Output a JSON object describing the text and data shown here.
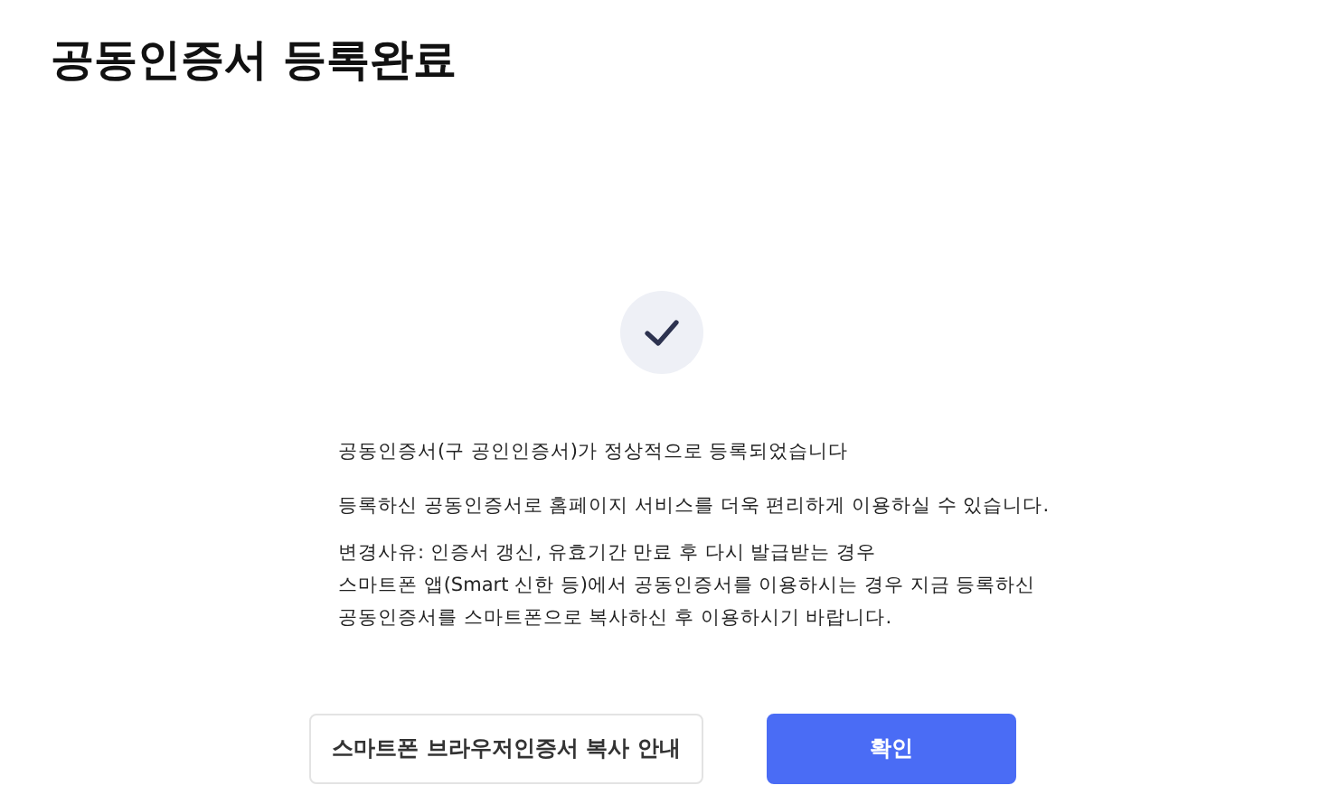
{
  "title": "공동인증서 등록완료",
  "message": {
    "headline": "공동인증서(구 공인인증서)가 정상적으로 등록되었습니다",
    "info": "등록하신 공동인증서로 홈페이지 서비스를 더욱 편리하게 이용하실 수 있습니다.",
    "notes": [
      "변경사유: 인증서 갱신, 유효기간 만료 후 다시 발급받는 경우",
      "스마트폰 앱(Smart 신한 등)에서 공동인증서를 이용하시는 경우 지금 등록하신",
      "공동인증서를 스마트폰으로 복사하신 후 이용하시기 바랍니다."
    ]
  },
  "buttons": [
    {
      "label": "스마트폰 브라우저인증서 복사 안내",
      "kind": "secondary"
    },
    {
      "label": "확인",
      "kind": "primary"
    }
  ]
}
